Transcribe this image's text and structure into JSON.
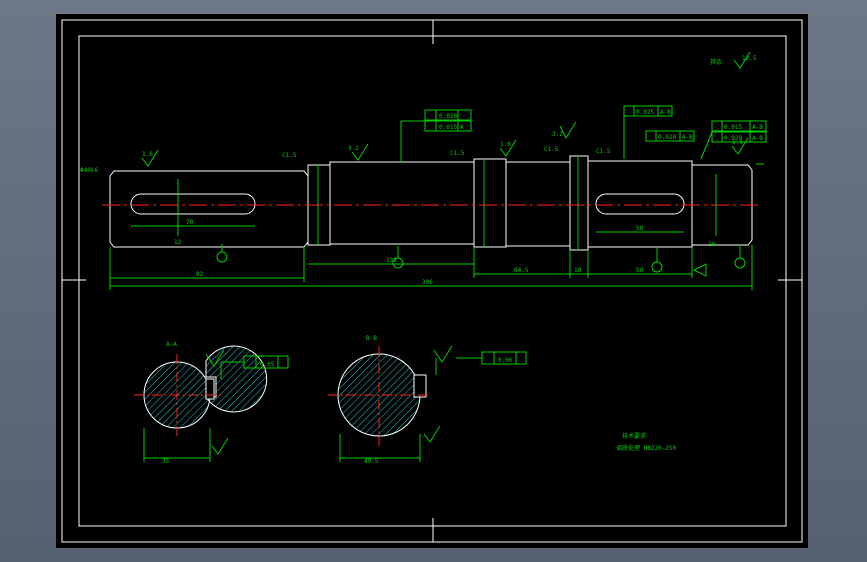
{
  "drawing": {
    "labels": {
      "roughness_note": "其余",
      "roughness_other": "12.5",
      "tol_1": "0.020",
      "tol_2": "0.015",
      "tol_3": "0.025",
      "tol_4": "0.020",
      "datum_ab": "A-B",
      "datum_a": "A",
      "ra_1": "1.6",
      "ra_2": "3.2",
      "ra_3": "1.6",
      "ra_4": "1.6",
      "ra_5": "3.2",
      "chamfer": "C1.5",
      "left_dia": "Φ40k6",
      "len_1": "82",
      "len_2": "70",
      "len_3": "58",
      "len_4": "138",
      "len_5": "50",
      "len_6": "64.5",
      "len_7": "10",
      "total_len": "306",
      "key_w1": "12",
      "key_w2": "16",
      "sec1_title": "A-A",
      "sec2_title": "B-B",
      "sec1_dim": "35",
      "sec2_dim": "49.5",
      "sec1_tol": "0.05",
      "sec2_tol": "0.06",
      "title_1": "技术要求",
      "title_2": "调质处理 HB220-250"
    }
  }
}
